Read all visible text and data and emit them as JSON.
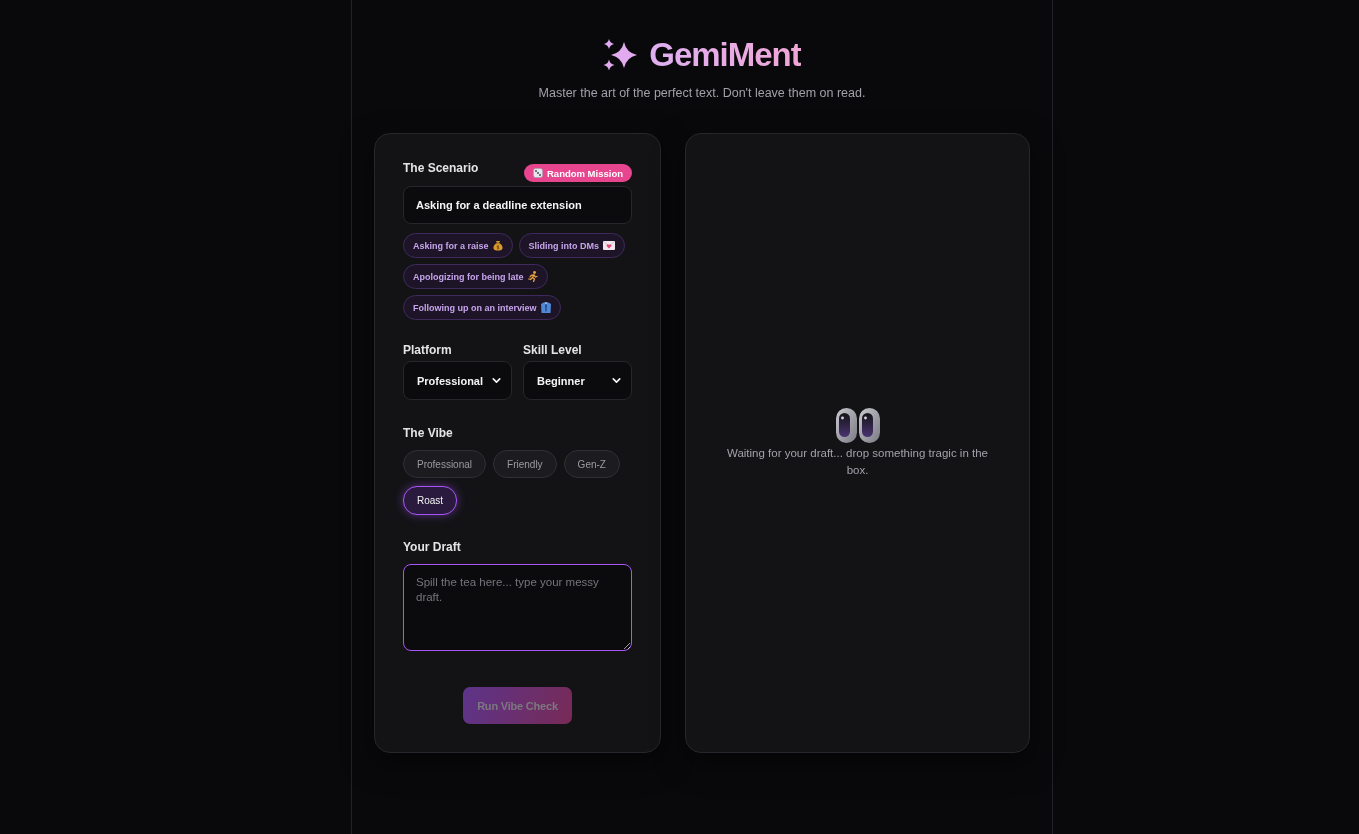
{
  "header": {
    "title": "GemiMent",
    "subtitle": "Master the art of the perfect text. Don't leave them on read."
  },
  "scenario": {
    "label": "The Scenario",
    "random_button": "Random Mission",
    "value": "Asking for a deadline extension",
    "suggestions": [
      "Asking for a raise",
      "Sliding into DMs",
      "Apologizing for being late",
      "Following up on an interview"
    ]
  },
  "platform": {
    "label": "Platform",
    "value": "Professional"
  },
  "skill_level": {
    "label": "Skill Level",
    "value": "Beginner"
  },
  "vibe": {
    "label": "The Vibe",
    "options": [
      {
        "label": "Professional",
        "selected": false
      },
      {
        "label": "Friendly",
        "selected": false
      },
      {
        "label": "Gen-Z",
        "selected": false
      },
      {
        "label": "Roast",
        "selected": true
      }
    ]
  },
  "draft": {
    "label": "Your Draft",
    "placeholder": "Spill the tea here... type your messy draft.",
    "focused": true
  },
  "run_button": {
    "label": "Run Vibe Check",
    "disabled": true
  },
  "output": {
    "empty_message": "Waiting for your draft... drop something tragic in the box."
  }
}
